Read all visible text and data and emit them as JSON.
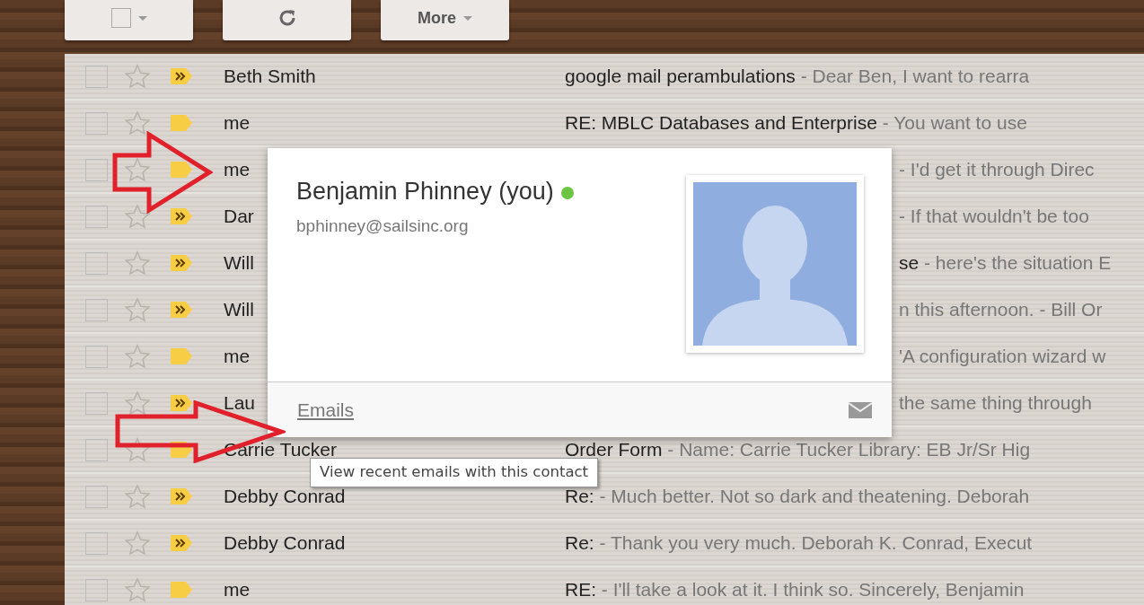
{
  "toolbar": {
    "more_label": "More"
  },
  "rows": [
    {
      "sender": "Beth Smith",
      "subject": "google mail perambulations",
      "snippet": "- Dear Ben, I want to rearra",
      "important": true,
      "covered": false,
      "checked": false
    },
    {
      "sender": "me",
      "subject": "RE: MBLC Databases and Enterprise",
      "snippet": "- You want to use",
      "important": false,
      "covered": false,
      "checked": false
    },
    {
      "sender": "me",
      "subject": "",
      "snippet": "- I'd get it through Direc",
      "important": false,
      "covered": true,
      "checked": false
    },
    {
      "sender": "Dar",
      "subject": "",
      "snippet": "- If that wouldn't be too",
      "important": true,
      "covered": true,
      "checked": false
    },
    {
      "sender": "Will",
      "subject": "se",
      "snippet": "- here's the situation E",
      "important": true,
      "covered": true,
      "checked": false
    },
    {
      "sender": "Will",
      "subject": "",
      "snippet": "n this afternoon. - Bill Or",
      "important": true,
      "covered": true,
      "checked": false
    },
    {
      "sender": "me",
      "subject": "",
      "snippet": "'A configuration wizard w",
      "important": false,
      "covered": true,
      "checked": false
    },
    {
      "sender": "Lau",
      "subject": "",
      "snippet": "the same thing through",
      "important": true,
      "covered": true,
      "checked": false
    },
    {
      "sender": "Carrie Tucker",
      "subject": "Order Form",
      "snippet": "- Name: Carrie Tucker Library: EB Jr/Sr Hig",
      "important": false,
      "covered": false,
      "checked": false
    },
    {
      "sender": "Debby Conrad",
      "subject": "Re:",
      "snippet": "- Much better. Not so dark and theatening. Deborah",
      "important": true,
      "covered": false,
      "checked": false
    },
    {
      "sender": "Debby Conrad",
      "subject": "Re:",
      "snippet": "- Thank you very much. Deborah K. Conrad, Execut",
      "important": true,
      "covered": false,
      "checked": false
    },
    {
      "sender": "me",
      "subject": "RE:",
      "snippet": "- I'll take a look at it. I think so. Sincerely, Benjamin",
      "important": false,
      "covered": false,
      "checked": false
    }
  ],
  "contact_card": {
    "name": "Benjamin Phinney (you)",
    "online": true,
    "email": "bphinney@sailsinc.org",
    "emails_link": "Emails"
  },
  "tooltip": "View recent emails with this contact"
}
